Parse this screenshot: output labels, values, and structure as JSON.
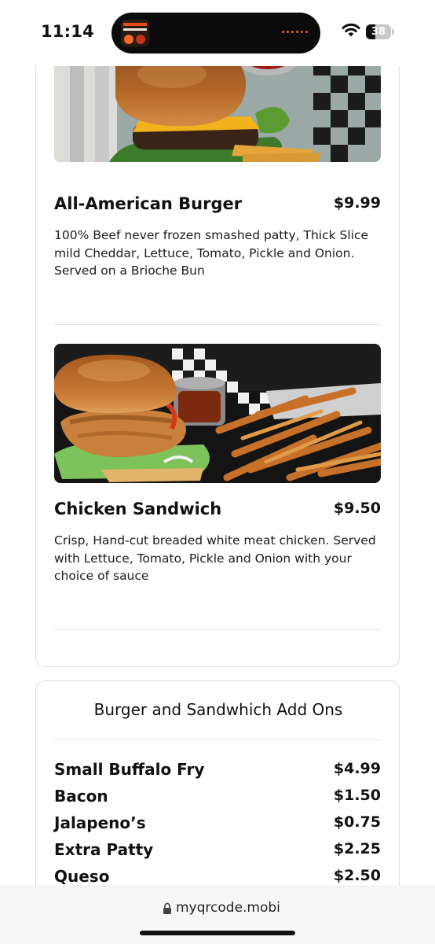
{
  "status_bar": {
    "time": "11:14",
    "battery": "38",
    "icons": [
      "wifi-icon",
      "battery-icon"
    ]
  },
  "menu": {
    "items": [
      {
        "name": "All-American Burger",
        "price": "$9.99",
        "description": "100% Beef never frozen smashed patty, Thick Slice mild Cheddar, Lettuce, Tomato, Pickle and Onion. Served on a Brioche Bun",
        "image": "burger-photo"
      },
      {
        "name": "Chicken Sandwich",
        "price": "$9.50",
        "description": "Crisp, Hand-cut breaded white meat chicken. Served with Lettuce, Tomato, Pickle and Onion with your choice of sauce",
        "image": "chicken-sandwich-photo"
      }
    ]
  },
  "addons": {
    "title": "Burger and Sandwhich Add Ons",
    "items": [
      {
        "name": "Small Buffalo Fry",
        "price": "$4.99"
      },
      {
        "name": "Bacon",
        "price": "$1.50"
      },
      {
        "name": "Jalapeno’s",
        "price": "$0.75"
      },
      {
        "name": "Extra Patty",
        "price": "$2.25"
      },
      {
        "name": "Queso",
        "price": "$2.50"
      }
    ]
  },
  "url_bar": {
    "url": "myqrcode.mobi",
    "icon": "lock-icon"
  }
}
